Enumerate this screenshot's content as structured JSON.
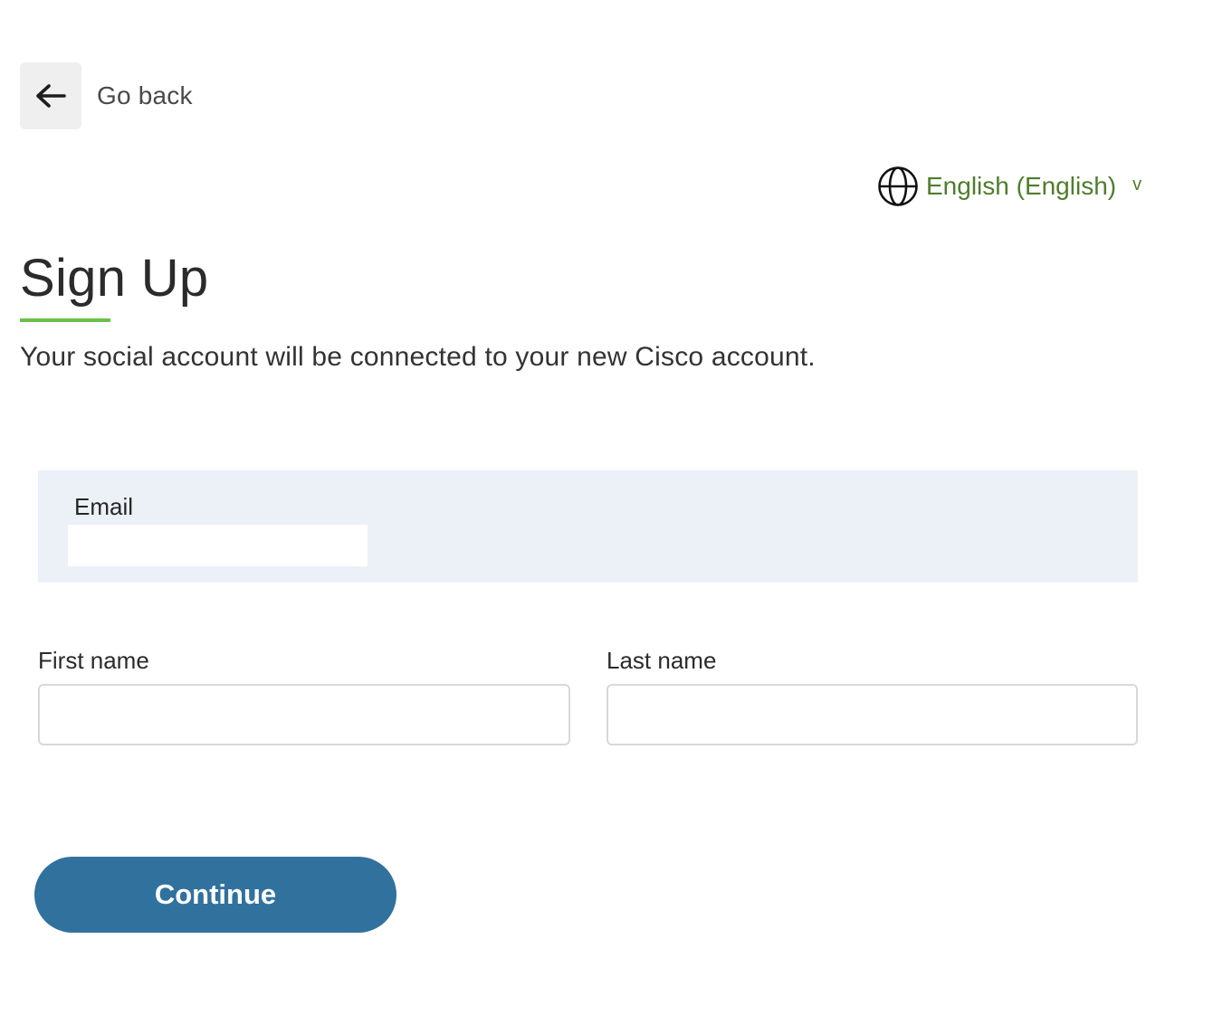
{
  "nav": {
    "back_label": "Go back"
  },
  "language": {
    "selected": "English (English)",
    "chevron": "v",
    "icon": "globe-icon"
  },
  "header": {
    "title": "Sign Up",
    "subtitle": "Your social account will be connected to your new Cisco account."
  },
  "form": {
    "email": {
      "label": "Email",
      "value": ""
    },
    "first_name": {
      "label": "First name",
      "value": ""
    },
    "last_name": {
      "label": "Last name",
      "value": ""
    },
    "continue_label": "Continue"
  },
  "colors": {
    "accent_green": "#6cc04a",
    "link_green": "#4e7d2c",
    "primary_blue": "#31719e",
    "email_panel_bg": "#ecf1f8"
  }
}
